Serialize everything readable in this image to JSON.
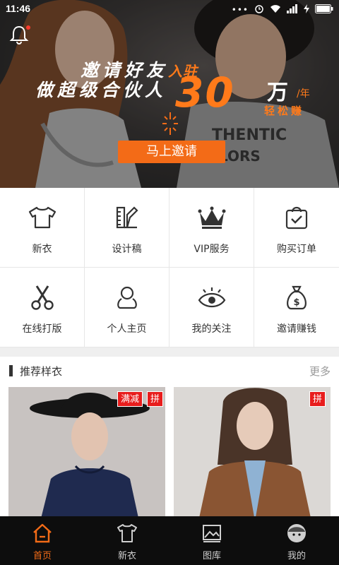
{
  "status_bar": {
    "time": "11:46"
  },
  "hero": {
    "promo_line1": "邀请好友",
    "promo_line1_accent": "入驻",
    "promo_line2": "做超级合伙人",
    "promo_amount": "30",
    "promo_unit": "万",
    "promo_per": "/年",
    "promo_easy": "轻松赚",
    "invite_button": "马上邀请",
    "accent_color": "#f36b17"
  },
  "grid": {
    "items": [
      {
        "label": "新衣",
        "icon": "tshirt-icon"
      },
      {
        "label": "设计稿",
        "icon": "design-ruler-icon"
      },
      {
        "label": "VIP服务",
        "icon": "crown-icon"
      },
      {
        "label": "购买订单",
        "icon": "order-bag-icon"
      },
      {
        "label": "在线打版",
        "icon": "scissors-icon"
      },
      {
        "label": "个人主页",
        "icon": "person-icon"
      },
      {
        "label": "我的关注",
        "icon": "eye-icon"
      },
      {
        "label": "邀请赚钱",
        "icon": "money-bag-icon"
      }
    ]
  },
  "recommend": {
    "title": "推荐样衣",
    "more": "更多",
    "products": [
      {
        "tags": [
          "满减",
          "拼"
        ]
      },
      {
        "tags": [
          "拼"
        ]
      }
    ]
  },
  "tabbar": {
    "tabs": [
      {
        "label": "首页",
        "icon": "home-icon",
        "active": true
      },
      {
        "label": "新衣",
        "icon": "tshirt-icon",
        "active": false
      },
      {
        "label": "图库",
        "icon": "gallery-icon",
        "active": false
      },
      {
        "label": "我的",
        "icon": "profile-icon",
        "active": false
      }
    ],
    "active_color": "#f36b17"
  }
}
